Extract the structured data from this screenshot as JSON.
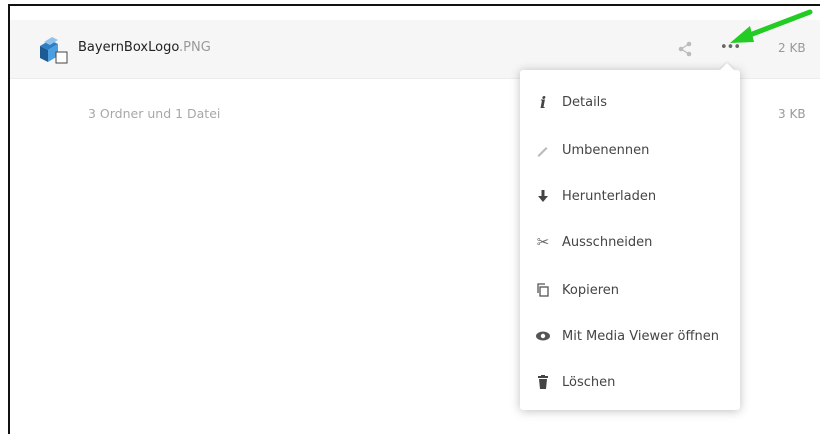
{
  "file": {
    "name": "BayernBoxLogo",
    "extension": ".PNG",
    "size": "2 KB",
    "icon": "image-file-icon"
  },
  "row_actions": {
    "share_icon": "share-icon",
    "more_icon": "more-icon",
    "more_label": "•••"
  },
  "summary": {
    "text": "3 Ordner und 1 Datei",
    "size": "3 KB"
  },
  "menu": {
    "items": [
      {
        "label": "Details",
        "icon": "info-icon"
      },
      {
        "label": "Umbenennen",
        "icon": "pencil-icon"
      },
      {
        "label": "Herunterladen",
        "icon": "download-icon"
      },
      {
        "label": "Ausschneiden",
        "icon": "scissors-icon"
      },
      {
        "label": "Kopieren",
        "icon": "copy-icon"
      },
      {
        "label": "Mit Media Viewer öffnen",
        "icon": "eye-icon"
      },
      {
        "label": "Löschen",
        "icon": "trash-icon"
      }
    ]
  },
  "colors": {
    "arrow": "#22cc22",
    "row_background": "#f6f6f6",
    "muted_text": "#999999"
  }
}
